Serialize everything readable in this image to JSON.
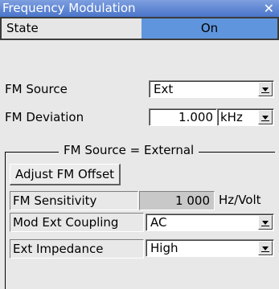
{
  "window": {
    "title": "Frequency Modulation",
    "close_glyph": "✕"
  },
  "state": {
    "label": "State",
    "value": "On"
  },
  "fm_source": {
    "label": "FM Source",
    "value": "Ext"
  },
  "fm_deviation": {
    "label": "FM Deviation",
    "value": "1.000",
    "unit": "kHz"
  },
  "external_group": {
    "legend": "FM Source = External",
    "adjust_offset_label": "Adjust FM Offset",
    "sensitivity": {
      "label": "FM Sensitivity",
      "value": "1 000",
      "unit": "Hz/Volt"
    },
    "coupling": {
      "label": "Mod Ext Coupling",
      "value": "AC"
    },
    "impedance": {
      "label": "Ext Impedance",
      "value": "High"
    }
  },
  "colors": {
    "title_bar": "#5a82d0",
    "state_on": "#5f95dd"
  }
}
